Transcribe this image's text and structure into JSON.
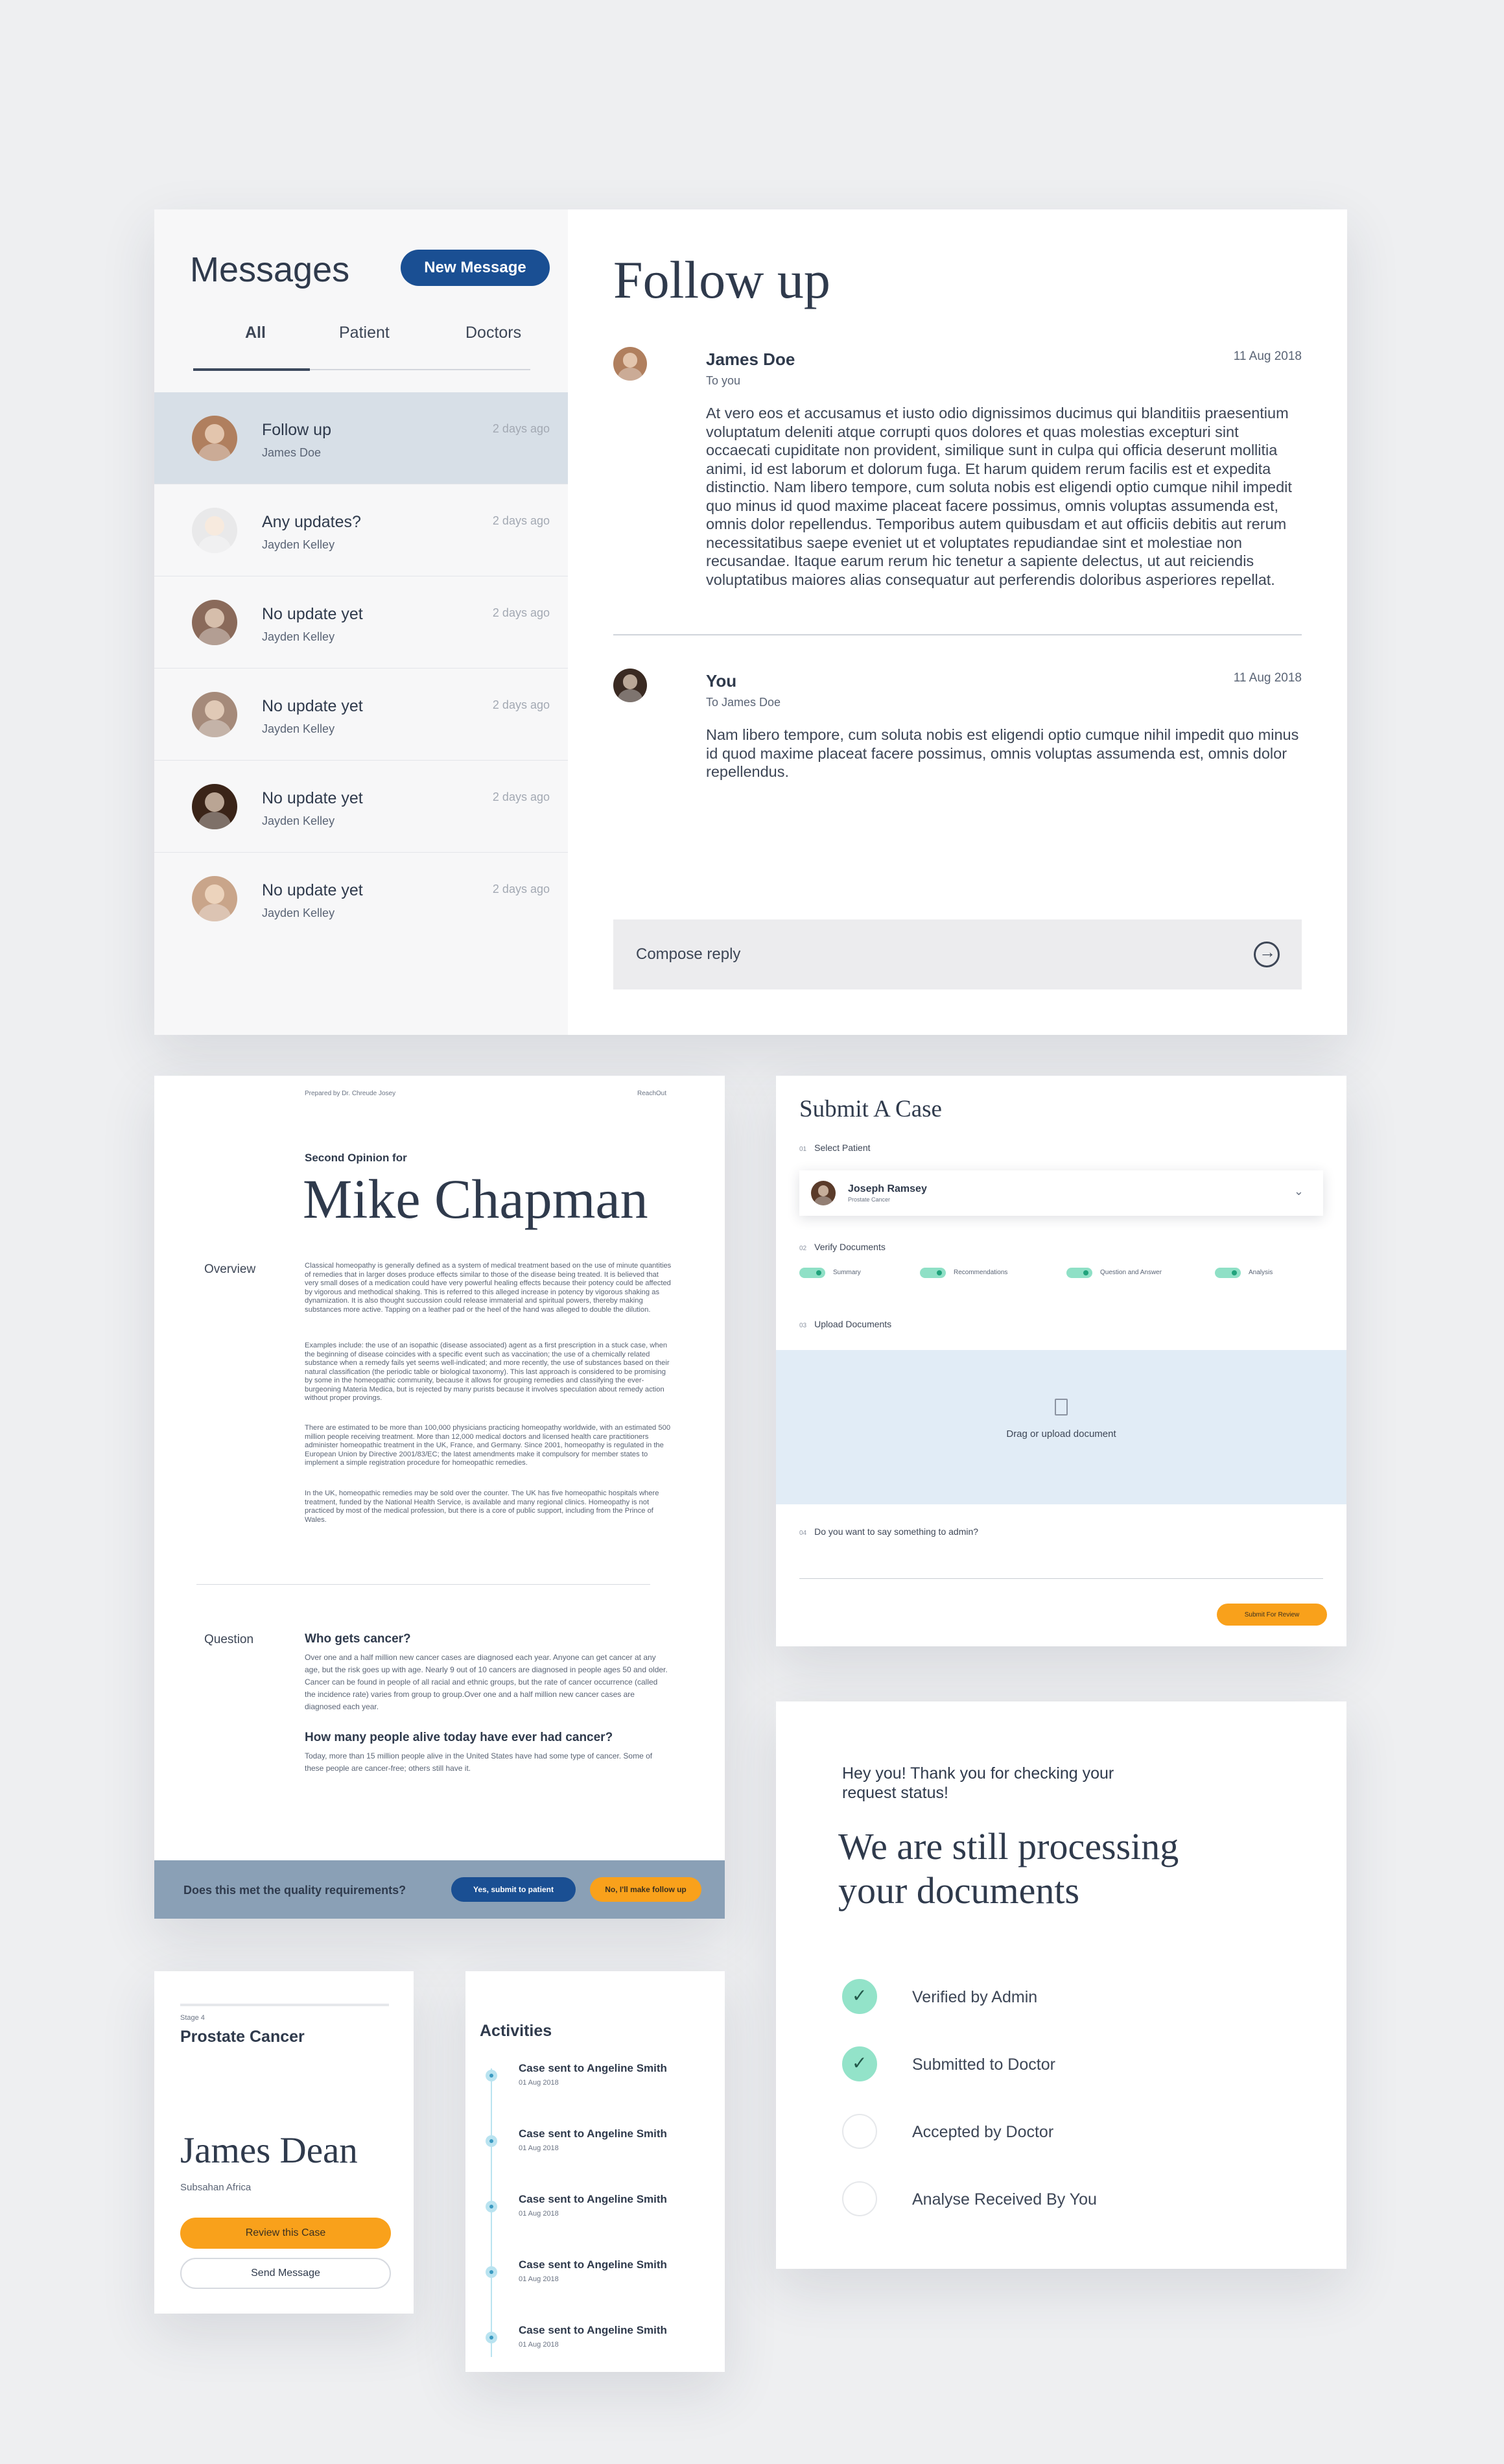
{
  "messages": {
    "title": "Messages",
    "new_message_label": "New Message",
    "tabs": [
      "All",
      "Patient",
      "Doctors"
    ],
    "conversations": [
      {
        "subject": "Follow up",
        "from": "James Doe",
        "time": "2 days ago",
        "avatar_color": "#b07f5e"
      },
      {
        "subject": "Any updates?",
        "from": "Jayden Kelley",
        "time": "2 days ago",
        "avatar_color": "#e9e9ea"
      },
      {
        "subject": "No update yet",
        "from": "Jayden Kelley",
        "time": "2 days ago",
        "avatar_color": "#8a6a5a"
      },
      {
        "subject": "No update yet",
        "from": "Jayden Kelley",
        "time": "2 days ago",
        "avatar_color": "#a58a7a"
      },
      {
        "subject": "No update yet",
        "from": "Jayden Kelley",
        "time": "2 days ago",
        "avatar_color": "#3a2418"
      },
      {
        "subject": "No update yet",
        "from": "Jayden Kelley",
        "time": "2 days ago",
        "avatar_color": "#c9a58a"
      }
    ]
  },
  "thread": {
    "title": "Follow up",
    "messages": [
      {
        "name": "James Doe",
        "to": "To you",
        "date": "11 Aug 2018",
        "body": "At vero eos et accusamus et iusto odio dignissimos ducimus qui blanditiis praesentium voluptatum deleniti atque corrupti quos dolores et quas molestias excepturi sint occaecati cupiditate non provident, similique sunt in culpa qui officia deserunt mollitia animi, id est laborum et dolorum fuga. Et harum quidem rerum facilis est et expedita distinctio. Nam libero tempore, cum soluta nobis est eligendi optio cumque nihil impedit quo minus id quod maxime placeat facere possimus, omnis voluptas assumenda est, omnis dolor repellendus. Temporibus autem quibusdam et aut officiis debitis aut rerum necessitatibus saepe eveniet ut et voluptates repudiandae sint et molestiae non recusandae. Itaque earum rerum hic tenetur a sapiente delectus, ut aut reiciendis voluptatibus maiores alias consequatur aut perferendis doloribus asperiores repellat."
      },
      {
        "name": "You",
        "to": "To James Doe",
        "date": "11 Aug 2018",
        "body": "Nam libero tempore, cum soluta nobis est eligendi optio cumque nihil impedit quo minus id quod maxime placeat facere possimus, omnis voluptas assumenda est, omnis dolor repellendus."
      }
    ],
    "compose_placeholder": "Compose reply"
  },
  "report": {
    "prepared_by": "Prepared by Dr. Chreude Josey",
    "brand": "ReachOut",
    "subtitle": "Second Opinion for",
    "patient_name": "Mike Chapman",
    "overview_label": "Overview",
    "overview_paragraphs": [
      "Classical homeopathy is generally defined as a system of medical treatment based on the use of minute quantities of remedies that in larger doses produce effects similar to those of the disease being treated. It is believed that very small doses of a medication could have very powerful healing effects because their potency could be affected by vigorous and methodical shaking. This is referred to this alleged increase in potency by vigorous shaking as dynamization. It is also thought succussion could release immaterial and spiritual powers, thereby making substances more active. Tapping on a leather pad or the heel of the hand was alleged to double the dilution.",
      "Examples include: the use of an isopathic (disease associated) agent as a first prescription in a stuck case, when the beginning of disease coincides with a specific event such as vaccination; the use of a chemically related substance when a remedy fails yet seems well-indicated; and more recently, the use of substances based on their natural classification (the periodic table or biological taxonomy). This last approach is considered to be promising by some in the homeopathic community, because it allows for grouping remedies and classifying the ever-burgeoning Materia Medica, but is rejected by many purists because it involves speculation about remedy action without proper provings.",
      "There are estimated to be more than 100,000 physicians practicing homeopathy worldwide, with an estimated 500 million people receiving treatment. More than 12,000 medical doctors and licensed health care practitioners administer homeopathic treatment in the UK, France, and Germany. Since 2001, homeopathy is regulated in the European Union by Directive 2001/83/EC; the latest amendments make it compulsory for member states to implement a simple registration procedure for homeopathic remedies.",
      "In the UK, homeopathic remedies may be sold over the counter. The UK has five homeopathic hospitals where treatment, funded by the National Health Service, is available and many regional clinics. Homeopathy is not practiced by most of the medical profession, but there is a core of public support, including from the Prince of Wales."
    ],
    "question_label": "Question",
    "questions": [
      {
        "q": "Who gets cancer?",
        "a": "Over one and a half million new cancer cases are diagnosed each year. Anyone can get cancer at any age, but the risk goes up with age. Nearly 9 out of 10 cancers are diagnosed in people ages 50 and older. Cancer can be found in people of all racial and ethnic groups, but the rate of cancer occurrence (called the incidence rate) varies from group to group.Over one and a half million new cancer cases are diagnosed each year."
      },
      {
        "q": "How many people alive today have ever had cancer?",
        "a": "Today, more than 15 million people alive in the United States have had some type of cancer. Some of these people are cancer-free; others still have it."
      }
    ],
    "footer_question": "Does this met the quality requirements?",
    "yes_label": "Yes, submit to patient",
    "no_label": "No, I'll make follow up"
  },
  "submit_case": {
    "title": "Submit A Case",
    "step1_num": "01",
    "step1_label": "Select Patient",
    "patient_name": "Joseph Ramsey",
    "patient_diagnosis": "Prostate Cancer",
    "step2_num": "02",
    "step2_label": "Verify Documents",
    "documents": [
      "Summary",
      "Recommendations",
      "Question and Answer",
      "Analysis"
    ],
    "step3_num": "03",
    "step3_label": "Upload Documents",
    "upload_label": "Drag or upload document",
    "step4_num": "04",
    "step4_label": "Do you want to say something to admin?",
    "submit_label": "Submit For Review"
  },
  "status": {
    "greeting": "Hey you! Thank you for checking your request status!",
    "heading": "We are still processing your documents",
    "steps": [
      {
        "label": "Verified by Admin",
        "done": true
      },
      {
        "label": "Submitted to Doctor",
        "done": true
      },
      {
        "label": "Accepted by Doctor",
        "done": false
      },
      {
        "label": "Analyse Received By You",
        "done": false
      }
    ]
  },
  "case_card": {
    "stage": "Stage 4",
    "diagnosis": "Prostate Cancer",
    "name": "James Dean",
    "region": "Subsahan Africa",
    "review_label": "Review this Case",
    "send_label": "Send Message"
  },
  "activities": {
    "title": "Activities",
    "items": [
      {
        "text": "Case sent to Angeline Smith",
        "date": "01 Aug 2018"
      },
      {
        "text": "Case sent to Angeline Smith",
        "date": "01 Aug 2018"
      },
      {
        "text": "Case sent to Angeline Smith",
        "date": "01 Aug 2018"
      },
      {
        "text": "Case sent to Angeline Smith",
        "date": "01 Aug 2018"
      },
      {
        "text": "Case sent to Angeline Smith",
        "date": "01 Aug 2018"
      }
    ]
  }
}
